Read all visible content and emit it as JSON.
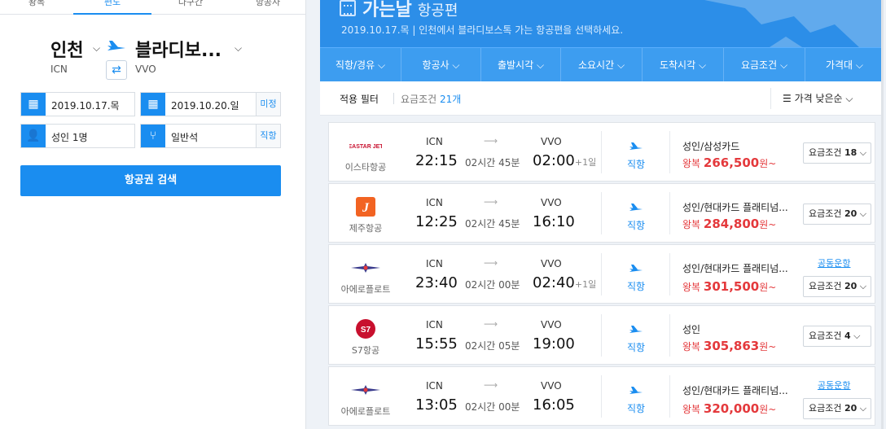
{
  "search": {
    "top_tabs": [
      "왕복",
      "편도",
      "다구간",
      "항공사"
    ],
    "origin_city": "인천",
    "origin_code": "ICN",
    "dest_city": "블라디보...",
    "dest_code": "VVO",
    "depart_date": "2019.10.17.목",
    "return_date": "2019.10.20.일",
    "return_tag": "미정",
    "passengers": "성인 1명",
    "seat_class": "일반석",
    "direct_tag": "직항",
    "search_button": "항공권 검색"
  },
  "header": {
    "title_bold": "가는날",
    "title_rest": "항공편",
    "subtitle": "2019.10.17.목 | 인천에서 블라디보스톡 가는 항공편을 선택하세요."
  },
  "filters": [
    "직항/경유",
    "항공사",
    "출발시각",
    "소요시간",
    "도착시각",
    "요금조건",
    "가격대"
  ],
  "applied": {
    "label": "적용 필터",
    "filter_name": "요금조건",
    "filter_count": "21개",
    "sort": "가격 낮은순"
  },
  "flights": [
    {
      "airline": "이스타항공",
      "logo": "EASTAR JET",
      "dep_code": "ICN",
      "dep_time": "22:15",
      "duration": "02시간 45분",
      "arr_code": "VVO",
      "arr_time": "02:00",
      "plus_day": "+1일",
      "direct": "직항",
      "fare": "성인/삼성카드",
      "price_prefix": "왕복",
      "price": "266,500",
      "price_unit": "원~",
      "codeshare": "",
      "cond_label": "요금조건",
      "cond_count": "18"
    },
    {
      "airline": "제주항공",
      "logo": "jeju",
      "dep_code": "ICN",
      "dep_time": "12:25",
      "duration": "02시간 45분",
      "arr_code": "VVO",
      "arr_time": "16:10",
      "plus_day": "",
      "direct": "직항",
      "fare": "성인/현대카드 플래티넘...",
      "price_prefix": "왕복",
      "price": "284,800",
      "price_unit": "원~",
      "codeshare": "",
      "cond_label": "요금조건",
      "cond_count": "20"
    },
    {
      "airline": "아에로플로트",
      "logo": "aeroflot",
      "dep_code": "ICN",
      "dep_time": "23:40",
      "duration": "02시간 00분",
      "arr_code": "VVO",
      "arr_time": "02:40",
      "plus_day": "+1일",
      "direct": "직항",
      "fare": "성인/현대카드 플래티넘...",
      "price_prefix": "왕복",
      "price": "301,500",
      "price_unit": "원~",
      "codeshare": "공동운항",
      "cond_label": "요금조건",
      "cond_count": "20"
    },
    {
      "airline": "S7항공",
      "logo": "S7",
      "dep_code": "ICN",
      "dep_time": "15:55",
      "duration": "02시간 05분",
      "arr_code": "VVO",
      "arr_time": "19:00",
      "plus_day": "",
      "direct": "직항",
      "fare": "성인",
      "price_prefix": "왕복",
      "price": "305,863",
      "price_unit": "원~",
      "codeshare": "",
      "cond_label": "요금조건",
      "cond_count": "4"
    },
    {
      "airline": "아에로플로트",
      "logo": "aeroflot",
      "dep_code": "ICN",
      "dep_time": "13:05",
      "duration": "02시간 00분",
      "arr_code": "VVO",
      "arr_time": "16:05",
      "plus_day": "",
      "direct": "직항",
      "fare": "성인/현대카드 플래티넘...",
      "price_prefix": "왕복",
      "price": "320,000",
      "price_unit": "원~",
      "codeshare": "공동운항",
      "cond_label": "요금조건",
      "cond_count": "20"
    }
  ],
  "colors": {
    "accent": "#1a8df0",
    "header": "#2c8ee8",
    "price": "#e4393c"
  }
}
